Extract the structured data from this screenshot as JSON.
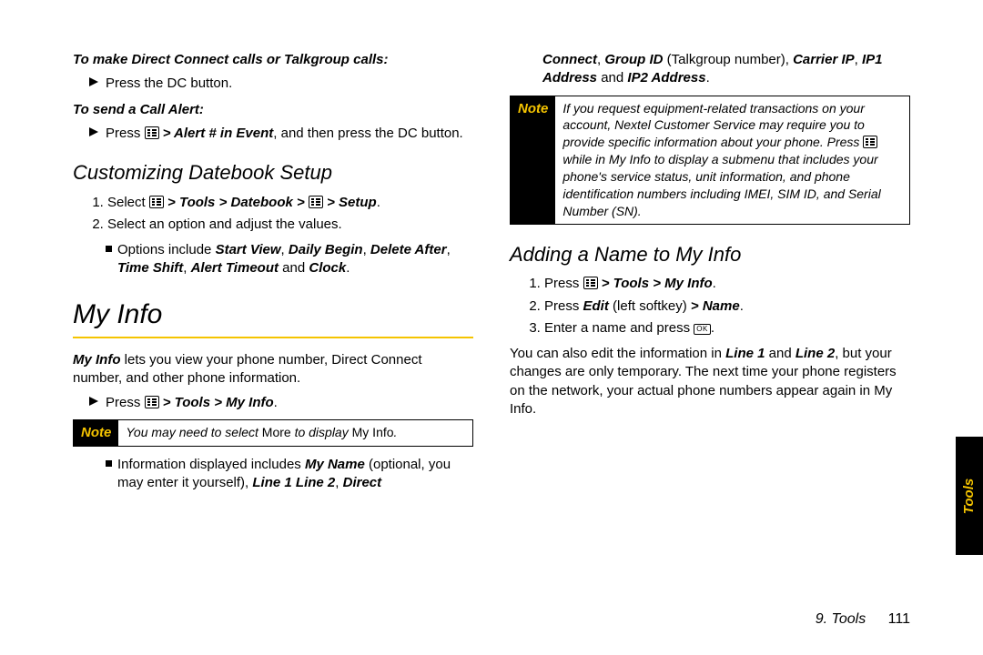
{
  "left": {
    "sub1": "To make Direct Connect calls or Talkgroup calls:",
    "b1": "Press the DC button.",
    "sub2": "To send a Call Alert:",
    "b2_pre": "Press ",
    "b2_path": "> Alert # in Event",
    "b2_post": ", and then press the DC button.",
    "h2a": "Customizing Datebook Setup",
    "ol1_pre": "Select ",
    "ol1_path": "> Tools > Datebook > ",
    "ol1_path2": " > Setup",
    "ol1_dot": ".",
    "ol2": "Select an option and adjust the values.",
    "opt_pre": "Options include ",
    "opt_and": " and ",
    "opt_dot": ".",
    "opts": {
      "a": "Start View",
      "b": "Daily Begin",
      "c": "Delete After",
      "d": "Time Shift",
      "e": "Alert Timeout",
      "f": "Clock"
    },
    "h1": "My Info",
    "p1_pre": "My Info",
    "p1_post": " lets you view your phone number, Direct Connect number, and other phone information.",
    "b3_pre": "Press ",
    "b3_path": "> Tools > My Info",
    "b3_dot": ".",
    "note_tag": "Note",
    "note1_a": "You may need to select ",
    "note1_b": "More",
    "note1_c": " to display ",
    "note1_d": "My Info",
    "note1_e": ".",
    "info_pre": "Information displayed includes ",
    "info_my": "My Name",
    "info_opt": " (optional, you may enter it yourself), ",
    "info_l1": "Line 1",
    "info_sp": " ",
    "info_l2": "Line 2",
    "info_com": ", ",
    "info_dc": "Direct"
  },
  "right": {
    "cont_a": "Connect",
    "cont_b": ", ",
    "cont_c": "Group ID",
    "cont_d": " (Talkgroup number), ",
    "cont_e": "Carrier IP",
    "cont_f": ", ",
    "cont_g": "IP1 Address",
    "cont_h": " and ",
    "cont_i": "IP2 Address",
    "cont_j": ".",
    "note_tag": "Note",
    "note2_a": "If you request equipment-related transactions on your account, Nextel Customer Service may require you to provide specific information about your phone. Press ",
    "note2_b": " while in My Info to display a submenu that includes your phone's service status, unit information, and phone identification numbers including IMEI, SIM ID, and Serial Number (SN).",
    "h2b": "Adding a Name to My Info",
    "ol1_pre": "Press ",
    "ol1_path": "> Tools > My Info",
    "ol1_dot": ".",
    "ol2_pre": "Press ",
    "ol2_edit": "Edit",
    "ol2_mid": " (left softkey) ",
    "ol2_name": "> Name",
    "ol2_dot": ".",
    "ol3_pre": "Enter a name and press ",
    "ol3_dot": ".",
    "p2_a": "You can also edit the information in ",
    "p2_l1": "Line 1",
    "p2_and": " and ",
    "p2_l2": "Line 2",
    "p2_b": ", but your changes are only temporary. The next time your phone registers on the network, your actual phone numbers appear again in My Info."
  },
  "side_tab": "Tools",
  "footer_section": "9. Tools",
  "footer_page": "111",
  "ok": "OK"
}
